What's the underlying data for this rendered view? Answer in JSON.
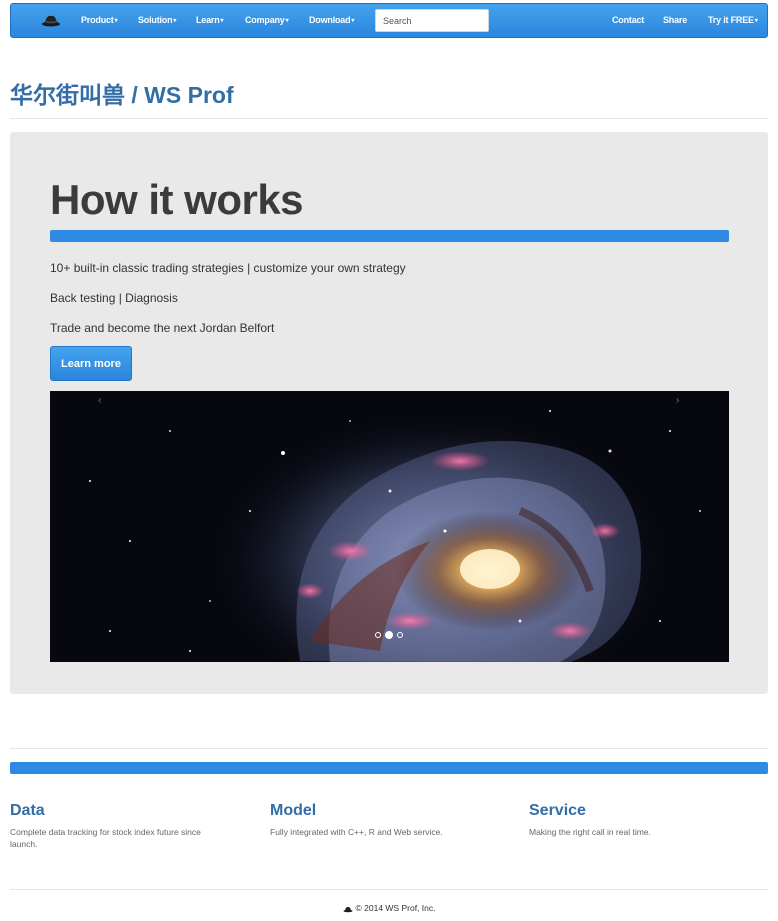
{
  "nav": {
    "items": [
      {
        "label": "Product",
        "caret": "▾"
      },
      {
        "label": "Solution",
        "caret": "▾"
      },
      {
        "label": "Learn",
        "caret": "▾"
      },
      {
        "label": "Company",
        "caret": "▾"
      },
      {
        "label": "Download",
        "caret": "▾"
      }
    ],
    "search_placeholder": "Search",
    "right_items": [
      {
        "label": "Contact"
      },
      {
        "label": "Share"
      },
      {
        "label": "Try it FREE",
        "caret": "▾"
      }
    ],
    "brand_icon": "hat-icon"
  },
  "page": {
    "title": "华尔街叫兽 / WS Prof"
  },
  "hero": {
    "heading": "How it works",
    "lines": [
      "10+ built-in classic trading strategies | customize your own strategy",
      "Back testing | Diagnosis",
      "Trade and become the next Jordan Belfort"
    ],
    "button_label": "Learn more",
    "carousel": {
      "image": "galaxy-image",
      "prev_glyph": "‹",
      "next_glyph": "›",
      "active_slide": 2,
      "slide_count": 3
    }
  },
  "features": [
    {
      "title": "Data",
      "text": "Complete data tracking for stock index future since launch."
    },
    {
      "title": "Model",
      "text": "Fully integrated with C++, R and Web service."
    },
    {
      "title": "Service",
      "text": "Making the right call in real time."
    }
  ],
  "footer": {
    "text": "© 2014 WS Prof, Inc.",
    "icon": "hat-icon"
  },
  "colors": {
    "accent": "#2f8ae3",
    "title_blue": "#336da8",
    "jumbotron_bg": "#e9e9e9"
  }
}
